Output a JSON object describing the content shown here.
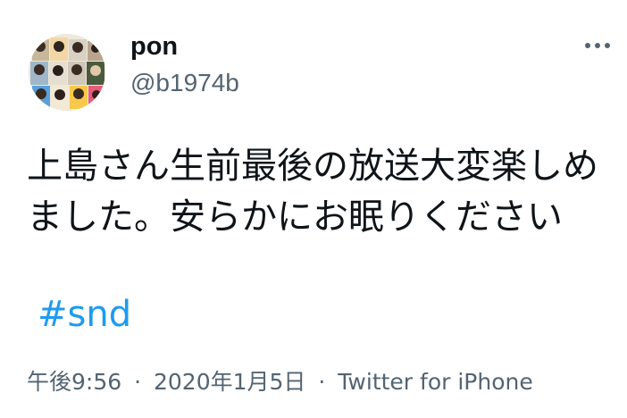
{
  "user": {
    "display_name": "pon",
    "handle": "@b1974b",
    "avatar_icon": "photo-collage-avatar"
  },
  "more_icon": "more-horizontal-icon",
  "tweet": {
    "text": "上島さん生前最後の放送大変楽しめました。安らかにお眠りください",
    "hashtag": "#snd"
  },
  "meta": {
    "time": "午後9:56",
    "date": "2020年1月5日",
    "separator": "·",
    "source": "Twitter for iPhone"
  },
  "colors": {
    "text": "#0f1419",
    "secondary": "#536471",
    "link": "#1d9bf0",
    "background": "#ffffff"
  }
}
